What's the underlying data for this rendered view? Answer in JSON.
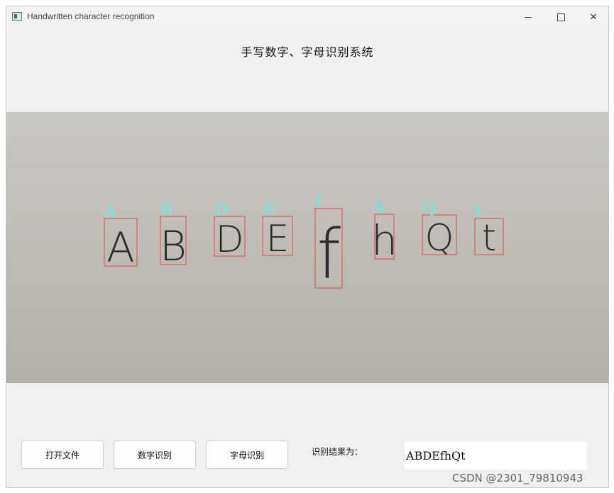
{
  "window": {
    "title": "Handwritten character recognition",
    "controls": {
      "minimize": "—",
      "maximize": "",
      "close": "✕"
    }
  },
  "app_title": "手写数字、字母识别系统",
  "image": {
    "detections": [
      {
        "label": "A",
        "glyph": "A"
      },
      {
        "label": "B",
        "glyph": "B"
      },
      {
        "label": "D",
        "glyph": "D"
      },
      {
        "label": "E",
        "glyph": "E"
      },
      {
        "label": "f",
        "glyph": "f"
      },
      {
        "label": "h",
        "glyph": "h"
      },
      {
        "label": "Q",
        "glyph": "Q"
      },
      {
        "label": "t",
        "glyph": "t"
      }
    ],
    "box_color": "#e04848",
    "label_color": "#5ef0ee"
  },
  "buttons": {
    "open_file": "打开文件",
    "digit_recognition": "数字识别",
    "letter_recognition": "字母识别"
  },
  "result": {
    "label": "识别结果为：",
    "value": "ABDEfhQt"
  },
  "watermark": "CSDN @2301_79810943"
}
